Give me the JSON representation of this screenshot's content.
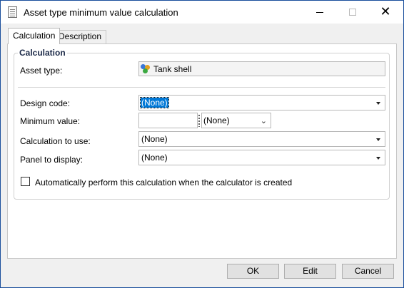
{
  "window": {
    "title": "Asset type minimum value calculation",
    "controls": {
      "minimize": "—",
      "maximize": "☐",
      "close": "✕"
    }
  },
  "tabs": [
    {
      "label": "Calculation",
      "active": true
    },
    {
      "label": "Description",
      "active": false
    }
  ],
  "group": {
    "title": "Calculation",
    "asset_type": {
      "label": "Asset type:",
      "value": "Tank shell",
      "icon": "asset-bubbles-icon"
    },
    "design_code": {
      "label": "Design code:",
      "value": "(None)",
      "selected": true
    },
    "minimum_value": {
      "label": "Minimum value:",
      "value": "",
      "unit": "(None)"
    },
    "calculation_to_use": {
      "label": "Calculation to use:",
      "value": "(None)"
    },
    "panel_to_display": {
      "label": "Panel to display:",
      "value": "(None)"
    },
    "auto_perform": {
      "label": "Automatically perform this calculation when the calculator is created",
      "checked": false
    }
  },
  "buttons": {
    "ok": "OK",
    "edit": "Edit",
    "cancel": "Cancel"
  },
  "colors": {
    "selection": "#0078d7",
    "window_border": "#1a4f9c",
    "panel_bg": "#ffffff",
    "chrome_bg": "#f0f0f0"
  }
}
